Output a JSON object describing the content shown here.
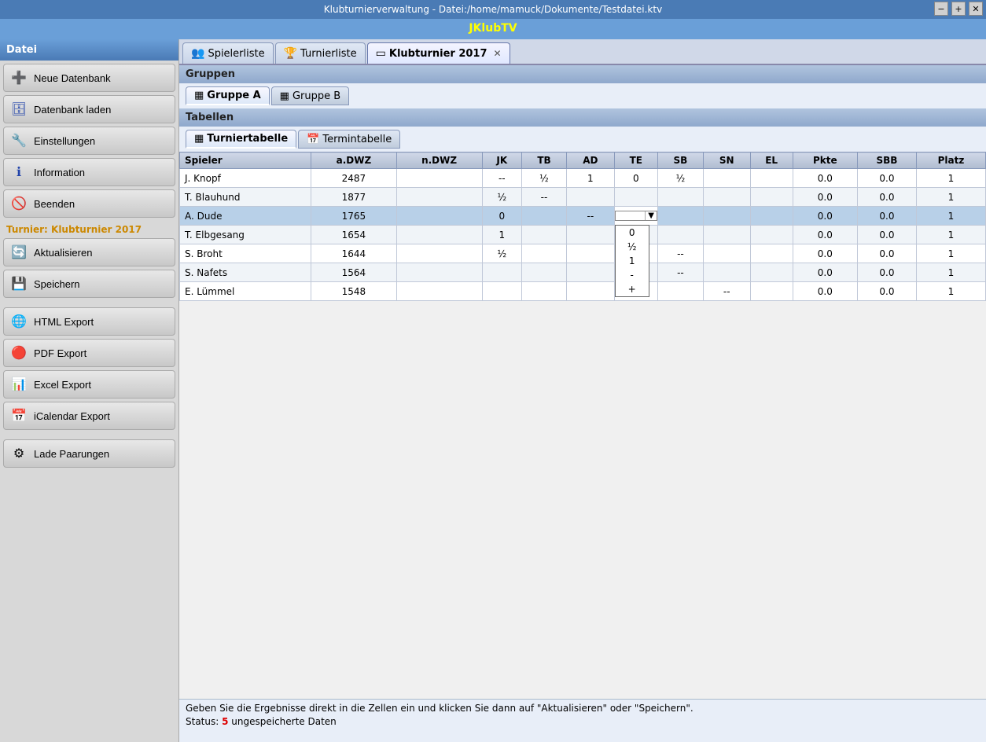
{
  "titlebar": {
    "title": "Klubturnierverwaltung - Datei:/home/mamuck/Dokumente/Testdatei.ktv",
    "min": "−",
    "max": "+",
    "close": "✕"
  },
  "appbar": {
    "title": "JKlubTV"
  },
  "sidebar": {
    "header": "Datei",
    "buttons": [
      {
        "id": "neue-datenbank",
        "label": "Neue Datenbank",
        "icon": "➕",
        "iconClass": "icon-green"
      },
      {
        "id": "datenbank-laden",
        "label": "Datenbank laden",
        "icon": "🗄",
        "iconClass": "icon-blue"
      },
      {
        "id": "einstellungen",
        "label": "Einstellungen",
        "icon": "🔧",
        "iconClass": "icon-teal"
      },
      {
        "id": "information",
        "label": "Information",
        "icon": "ℹ",
        "iconClass": "icon-blue"
      },
      {
        "id": "beenden",
        "label": "Beenden",
        "icon": "🚫",
        "iconClass": "icon-red"
      }
    ],
    "turnier_label": "Turnier: Klubturnier 2017",
    "turnier_buttons": [
      {
        "id": "aktualisieren",
        "label": "Aktualisieren",
        "icon": "🔄",
        "iconClass": "icon-green"
      },
      {
        "id": "speichern",
        "label": "Speichern",
        "icon": "💾",
        "iconClass": ""
      }
    ],
    "export_buttons": [
      {
        "id": "html-export",
        "label": "HTML Export",
        "icon": "🌐",
        "iconClass": "icon-blue"
      },
      {
        "id": "pdf-export",
        "label": "PDF Export",
        "icon": "🔴",
        "iconClass": "icon-red"
      },
      {
        "id": "excel-export",
        "label": "Excel Export",
        "icon": "📊",
        "iconClass": "icon-green"
      },
      {
        "id": "icalendar-export",
        "label": "iCalendar Export",
        "icon": "📅",
        "iconClass": "icon-cal"
      }
    ],
    "paarungen_button": {
      "id": "lade-paarungen",
      "label": "Lade Paarungen",
      "icon": "⚙",
      "iconClass": ""
    }
  },
  "tabs": [
    {
      "id": "spielerliste",
      "label": "Spielerliste",
      "icon": "👥",
      "active": false,
      "closable": false
    },
    {
      "id": "turnierliste",
      "label": "Turnierliste",
      "icon": "🏆",
      "active": false,
      "closable": false
    },
    {
      "id": "klubturnier",
      "label": "Klubturnier 2017",
      "icon": "▭",
      "active": true,
      "closable": true
    }
  ],
  "groups": {
    "header": "Gruppen",
    "tabs": [
      {
        "id": "gruppe-a",
        "label": "Gruppe A",
        "icon": "▦",
        "active": true
      },
      {
        "id": "gruppe-b",
        "label": "Gruppe B",
        "icon": "▦",
        "active": false
      }
    ]
  },
  "tabellen": {
    "header": "Tabellen",
    "tabs": [
      {
        "id": "turniertabelle",
        "label": "Turniertabelle",
        "icon": "▦",
        "active": true
      },
      {
        "id": "termintabelle",
        "label": "Termintabelle",
        "icon": "📅",
        "active": false
      }
    ]
  },
  "table": {
    "columns": [
      "Spieler",
      "a.DWZ",
      "n.DWZ",
      "JK",
      "TB",
      "AD",
      "TE",
      "SB",
      "SN",
      "EL",
      "Pkte",
      "SBB",
      "Platz"
    ],
    "rows": [
      {
        "spieler": "J. Knopf",
        "adwz": "2487",
        "ndwz": "",
        "jk": "--",
        "tb": "½",
        "ad": "1",
        "te": "0",
        "te_dropdown": false,
        "sb": "½",
        "sn": "",
        "el": "",
        "pkte": "0.0",
        "sbb": "0.0",
        "platz": "1"
      },
      {
        "spieler": "T. Blauhund",
        "adwz": "1877",
        "ndwz": "",
        "jk": "½",
        "tb": "--",
        "ad": "",
        "te": "",
        "te_dropdown": false,
        "sb": "",
        "sn": "",
        "el": "",
        "pkte": "0.0",
        "sbb": "0.0",
        "platz": "1"
      },
      {
        "spieler": "A. Dude",
        "adwz": "1765",
        "ndwz": "",
        "jk": "0",
        "tb": "",
        "ad": "--",
        "te": "",
        "te_dropdown": true,
        "sb": "",
        "sn": "",
        "el": "",
        "pkte": "0.0",
        "sbb": "0.0",
        "platz": "1",
        "selected": true
      },
      {
        "spieler": "T. Elbgesang",
        "adwz": "1654",
        "ndwz": "",
        "jk": "1",
        "tb": "",
        "ad": "",
        "te": "",
        "te_dropdown": false,
        "sb": "",
        "sn": "",
        "el": "",
        "pkte": "0.0",
        "sbb": "0.0",
        "platz": "1"
      },
      {
        "spieler": "S. Broht",
        "adwz": "1644",
        "ndwz": "",
        "jk": "½",
        "tb": "",
        "ad": "",
        "te": "",
        "te_dropdown": false,
        "sb": "--",
        "sn": "",
        "el": "",
        "pkte": "0.0",
        "sbb": "0.0",
        "platz": "1"
      },
      {
        "spieler": "S. Nafets",
        "adwz": "1564",
        "ndwz": "",
        "jk": "",
        "tb": "",
        "ad": "",
        "te": "",
        "te_dropdown": false,
        "sb": "--",
        "sn": "",
        "el": "",
        "pkte": "0.0",
        "sbb": "0.0",
        "platz": "1"
      },
      {
        "spieler": "E. Lümmel",
        "adwz": "1548",
        "ndwz": "",
        "jk": "",
        "tb": "",
        "ad": "",
        "te": "",
        "te_dropdown": false,
        "sb": "",
        "sn": "--",
        "el": "",
        "pkte": "0.0",
        "sbb": "0.0",
        "platz": "1"
      }
    ],
    "dropdown_options": [
      "0",
      "½",
      "1",
      "-",
      "+"
    ]
  },
  "statusbar": {
    "hint": "Geben Sie die Ergebnisse direkt in die Zellen ein und klicken Sie dann auf \"Aktualisieren\" oder \"Speichern\".",
    "status_prefix": "Status: ",
    "status_count": "5",
    "status_suffix": " ungespeicherte Daten"
  }
}
